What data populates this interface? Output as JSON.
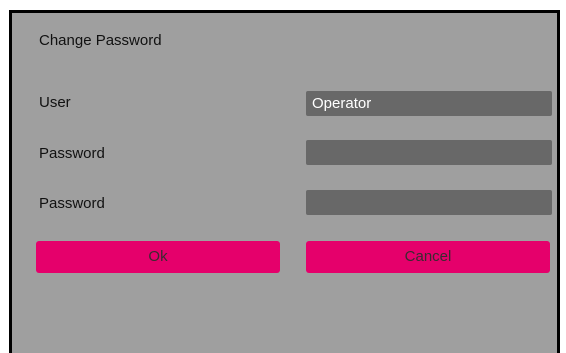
{
  "dialog": {
    "title": "Change Password",
    "user_label": "User",
    "user_value": "Operator",
    "password_label": "Password",
    "password_value": "",
    "confirm_password_label": "Password",
    "confirm_password_value": "",
    "ok_label": "Ok",
    "cancel_label": "Cancel"
  },
  "colors": {
    "dialog_background": "#9f9f9f",
    "field_background": "#686868",
    "button_accent": "#e5006b",
    "border": "#000000"
  }
}
